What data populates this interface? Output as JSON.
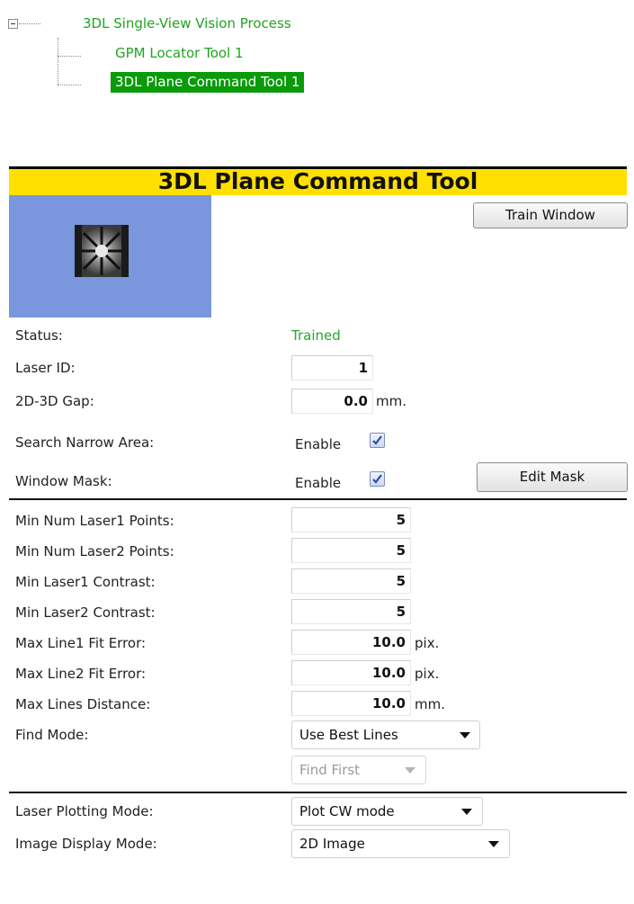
{
  "tree": {
    "root_label": "3DL Single-View Vision Process",
    "children": [
      {
        "label": "GPM Locator Tool 1"
      },
      {
        "label": "3DL Plane Command Tool 1"
      }
    ]
  },
  "tool": {
    "title": "3DL Plane Command Tool",
    "train_window_label": "Train Window",
    "edit_mask_label": "Edit Mask"
  },
  "fields": {
    "status": {
      "label": "Status:",
      "value": "Trained"
    },
    "laser_id": {
      "label": "Laser ID:",
      "value": "1"
    },
    "gap": {
      "label": "2D-3D Gap:",
      "value": "0.0",
      "unit": "mm."
    },
    "search_narrow": {
      "label": "Search Narrow Area:",
      "option": "Enable",
      "checked": true
    },
    "window_mask": {
      "label": "Window Mask:",
      "option": "Enable",
      "checked": true
    },
    "min_l1_points": {
      "label": "Min Num Laser1 Points:",
      "value": "5"
    },
    "min_l2_points": {
      "label": "Min Num Laser2 Points:",
      "value": "5"
    },
    "min_l1_contrast": {
      "label": "Min Laser1 Contrast:",
      "value": "5"
    },
    "min_l2_contrast": {
      "label": "Min Laser2 Contrast:",
      "value": "5"
    },
    "max_line1_err": {
      "label": "Max Line1 Fit Error:",
      "value": "10.0",
      "unit": "pix."
    },
    "max_line2_err": {
      "label": "Max Line2 Fit Error:",
      "value": "10.0",
      "unit": "pix."
    },
    "max_lines_dist": {
      "label": "Max Lines Distance:",
      "value": "10.0",
      "unit": "mm."
    },
    "find_mode": {
      "label": "Find Mode:",
      "value": "Use Best Lines",
      "sub_value": "Find First"
    },
    "laser_plot_mode": {
      "label": "Laser Plotting Mode:",
      "value": "Plot CW mode"
    },
    "image_display_mode": {
      "label": "Image Display Mode:",
      "value": "2D Image"
    }
  },
  "colors": {
    "header_bg": "#ffe000",
    "tree_text": "#1fa51f",
    "tree_selected_bg": "#0a9a0a",
    "preview_bg": "#7a96dc",
    "status_text": "#2aa52a"
  }
}
